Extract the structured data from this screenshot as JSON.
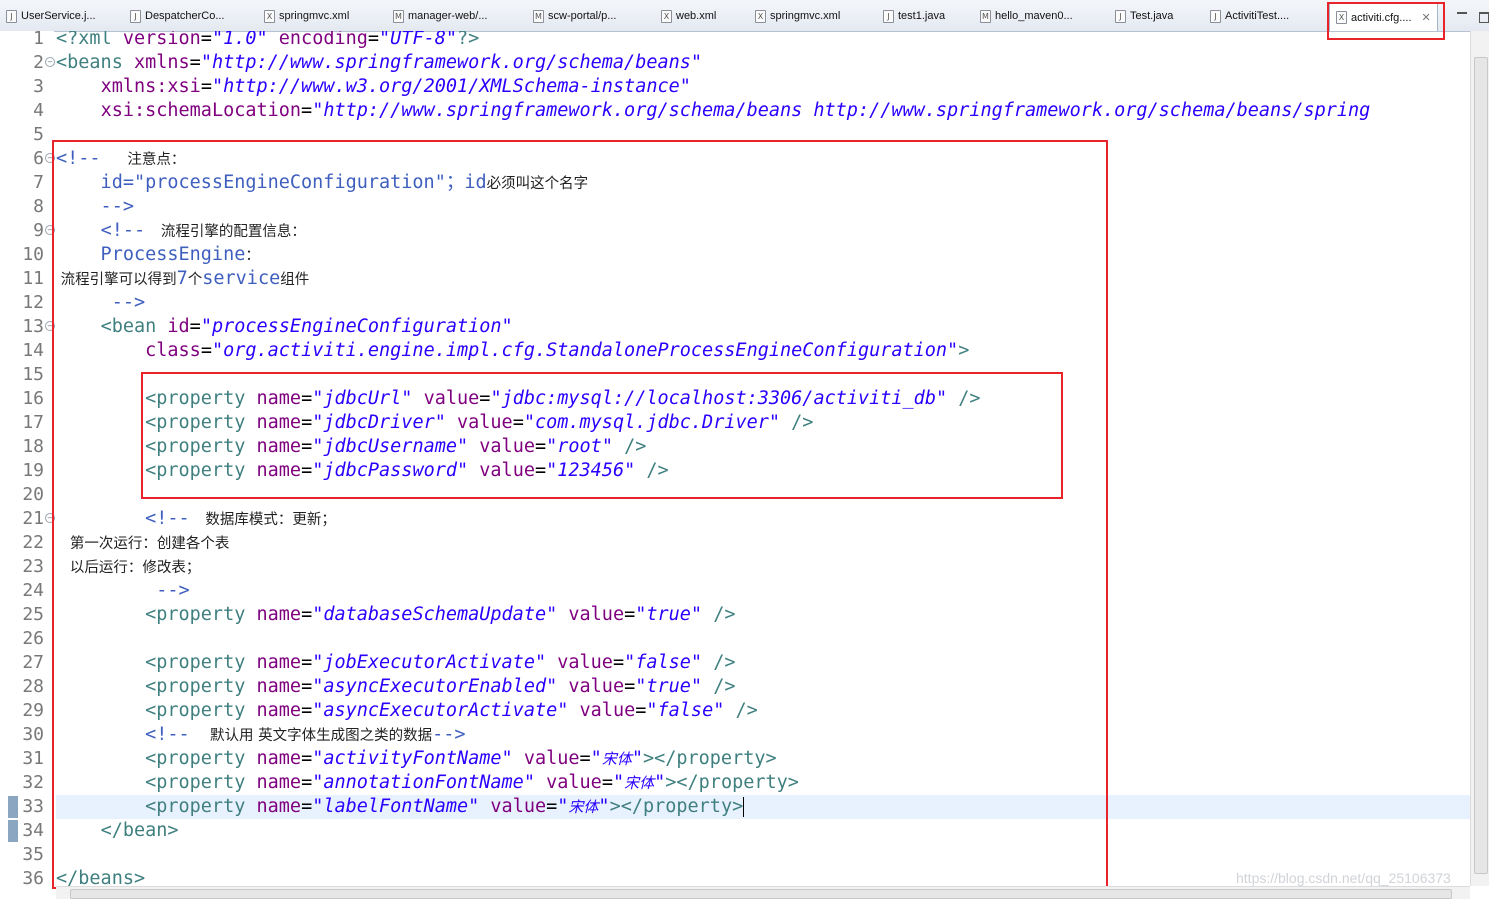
{
  "tabs": [
    {
      "label": "UserService.j...",
      "icon": "java-file-icon"
    },
    {
      "label": "DespatcherCo...",
      "icon": "java-file-icon"
    },
    {
      "label": "springmvc.xml",
      "icon": "xml-file-icon"
    },
    {
      "label": "manager-web/...",
      "icon": "maven-pom-icon"
    },
    {
      "label": "scw-portal/p...",
      "icon": "maven-pom-icon"
    },
    {
      "label": "web.xml",
      "icon": "xml-file-icon"
    },
    {
      "label": "springmvc.xml",
      "icon": "xml-file-icon"
    },
    {
      "label": "test1.java",
      "icon": "java-file-icon"
    },
    {
      "label": "hello_maven0...",
      "icon": "maven-pom-icon"
    },
    {
      "label": "Test.java",
      "icon": "java-file-icon"
    },
    {
      "label": "ActivitiTest....",
      "icon": "java-file-icon"
    },
    {
      "label": "activiti.cfg....",
      "icon": "xml-file-icon",
      "active": true
    }
  ],
  "editor": {
    "line_numbers": [
      "1",
      "2",
      "3",
      "4",
      "5",
      "6",
      "7",
      "8",
      "9",
      "10",
      "11",
      "12",
      "13",
      "14",
      "15",
      "16",
      "17",
      "18",
      "19",
      "20",
      "21",
      "22",
      "23",
      "24",
      "25",
      "26",
      "27",
      "28",
      "29",
      "30",
      "31",
      "32",
      "33",
      "34",
      "35",
      "36"
    ],
    "lines": [
      [
        [
          "t-tag",
          "<?xml "
        ],
        [
          "t-attr",
          "version"
        ],
        [
          "t-txt",
          "="
        ],
        [
          "t-val",
          "\"1.0\""
        ],
        [
          "t-txt",
          " "
        ],
        [
          "t-attr",
          "encoding"
        ],
        [
          "t-txt",
          "="
        ],
        [
          "t-val",
          "\"UTF-8\""
        ],
        [
          "t-tag",
          "?>"
        ]
      ],
      [
        [
          "t-tag",
          "<beans "
        ],
        [
          "t-attr",
          "xmlns"
        ],
        [
          "t-txt",
          "="
        ],
        [
          "t-val",
          "\"http://www.springframework.org/schema/beans\""
        ]
      ],
      [
        [
          "t-txt",
          "    "
        ],
        [
          "t-attr",
          "xmlns:xsi"
        ],
        [
          "t-txt",
          "="
        ],
        [
          "t-val",
          "\"http://www.w3.org/2001/XMLSchema-instance\""
        ]
      ],
      [
        [
          "t-txt",
          "    "
        ],
        [
          "t-attr",
          "xsi:schemaLocation"
        ],
        [
          "t-txt",
          "="
        ],
        [
          "t-val",
          "\"http://www.springframework.org/schema/beans http://www.springframework.org/schema/beans/spring"
        ]
      ],
      [],
      [
        [
          "t-com",
          "<!--  "
        ],
        [
          "t-com-cn",
          " 注意点："
        ]
      ],
      [
        [
          "t-com",
          "    id=\"processEngineConfiguration\"；id"
        ],
        [
          "t-com-cn",
          "必须叫这个名字"
        ]
      ],
      [
        [
          "t-com",
          "    -->"
        ]
      ],
      [
        [
          "t-txt",
          "    "
        ],
        [
          "t-com",
          "<!-- "
        ],
        [
          "t-com-cn",
          " 流程引擎的配置信息："
        ]
      ],
      [
        [
          "t-com",
          "    ProcessEngine"
        ],
        [
          "t-com-cn",
          "："
        ]
      ],
      [
        [
          "t-com-cn",
          " 流程引擎可以得到"
        ],
        [
          "t-com",
          "7"
        ],
        [
          "t-com-cn",
          "个"
        ],
        [
          "t-com",
          "service"
        ],
        [
          "t-com-cn",
          "组件"
        ]
      ],
      [
        [
          "t-com",
          "     -->"
        ]
      ],
      [
        [
          "t-txt",
          "    "
        ],
        [
          "t-tag",
          "<bean "
        ],
        [
          "t-attr",
          "id"
        ],
        [
          "t-txt",
          "="
        ],
        [
          "t-val",
          "\"processEngineConfiguration\""
        ]
      ],
      [
        [
          "t-txt",
          "        "
        ],
        [
          "t-attr",
          "class"
        ],
        [
          "t-txt",
          "="
        ],
        [
          "t-val",
          "\"org.activiti.engine.impl.cfg.StandaloneProcessEngineConfiguration\""
        ],
        [
          "t-tag",
          ">"
        ]
      ],
      [],
      [
        [
          "t-txt",
          "        "
        ],
        [
          "t-tag",
          "<property "
        ],
        [
          "t-attr",
          "name"
        ],
        [
          "t-txt",
          "="
        ],
        [
          "t-val",
          "\"jdbcUrl\""
        ],
        [
          "t-txt",
          " "
        ],
        [
          "t-attr",
          "value"
        ],
        [
          "t-txt",
          "="
        ],
        [
          "t-val",
          "\"jdbc:mysql://localhost:3306/activiti_db\""
        ],
        [
          "t-txt",
          " "
        ],
        [
          "t-tag",
          "/>"
        ]
      ],
      [
        [
          "t-txt",
          "        "
        ],
        [
          "t-tag",
          "<property "
        ],
        [
          "t-attr",
          "name"
        ],
        [
          "t-txt",
          "="
        ],
        [
          "t-val",
          "\"jdbcDriver\""
        ],
        [
          "t-txt",
          " "
        ],
        [
          "t-attr",
          "value"
        ],
        [
          "t-txt",
          "="
        ],
        [
          "t-val",
          "\"com.mysql.jdbc.Driver\""
        ],
        [
          "t-txt",
          " "
        ],
        [
          "t-tag",
          "/>"
        ]
      ],
      [
        [
          "t-txt",
          "        "
        ],
        [
          "t-tag",
          "<property "
        ],
        [
          "t-attr",
          "name"
        ],
        [
          "t-txt",
          "="
        ],
        [
          "t-val",
          "\"jdbcUsername\""
        ],
        [
          "t-txt",
          " "
        ],
        [
          "t-attr",
          "value"
        ],
        [
          "t-txt",
          "="
        ],
        [
          "t-val",
          "\"root\""
        ],
        [
          "t-txt",
          " "
        ],
        [
          "t-tag",
          "/>"
        ]
      ],
      [
        [
          "t-txt",
          "        "
        ],
        [
          "t-tag",
          "<property "
        ],
        [
          "t-attr",
          "name"
        ],
        [
          "t-txt",
          "="
        ],
        [
          "t-val",
          "\"jdbcPassword\""
        ],
        [
          "t-txt",
          " "
        ],
        [
          "t-attr",
          "value"
        ],
        [
          "t-txt",
          "="
        ],
        [
          "t-val",
          "\"123456\""
        ],
        [
          "t-txt",
          " "
        ],
        [
          "t-tag",
          "/>"
        ]
      ],
      [],
      [
        [
          "t-txt",
          "        "
        ],
        [
          "t-com",
          "<!-- "
        ],
        [
          "t-com-cn",
          " 数据库模式：更新；"
        ]
      ],
      [
        [
          "t-com-cn",
          "   第一次运行：创建各个表"
        ]
      ],
      [
        [
          "t-com-cn",
          "   以后运行：修改表；"
        ]
      ],
      [
        [
          "t-com",
          "         -->"
        ]
      ],
      [
        [
          "t-txt",
          "        "
        ],
        [
          "t-tag",
          "<property "
        ],
        [
          "t-attr",
          "name"
        ],
        [
          "t-txt",
          "="
        ],
        [
          "t-val",
          "\"databaseSchemaUpdate\""
        ],
        [
          "t-txt",
          " "
        ],
        [
          "t-attr",
          "value"
        ],
        [
          "t-txt",
          "="
        ],
        [
          "t-val",
          "\"true\""
        ],
        [
          "t-txt",
          " "
        ],
        [
          "t-tag",
          "/>"
        ]
      ],
      [],
      [
        [
          "t-txt",
          "        "
        ],
        [
          "t-tag",
          "<property "
        ],
        [
          "t-attr",
          "name"
        ],
        [
          "t-txt",
          "="
        ],
        [
          "t-val",
          "\"jobExecutorActivate\""
        ],
        [
          "t-txt",
          " "
        ],
        [
          "t-attr",
          "value"
        ],
        [
          "t-txt",
          "="
        ],
        [
          "t-val",
          "\"false\""
        ],
        [
          "t-txt",
          " "
        ],
        [
          "t-tag",
          "/>"
        ]
      ],
      [
        [
          "t-txt",
          "        "
        ],
        [
          "t-tag",
          "<property "
        ],
        [
          "t-attr",
          "name"
        ],
        [
          "t-txt",
          "="
        ],
        [
          "t-val",
          "\"asyncExecutorEnabled\""
        ],
        [
          "t-txt",
          " "
        ],
        [
          "t-attr",
          "value"
        ],
        [
          "t-txt",
          "="
        ],
        [
          "t-val",
          "\"true\""
        ],
        [
          "t-txt",
          " "
        ],
        [
          "t-tag",
          "/>"
        ]
      ],
      [
        [
          "t-txt",
          "        "
        ],
        [
          "t-tag",
          "<property "
        ],
        [
          "t-attr",
          "name"
        ],
        [
          "t-txt",
          "="
        ],
        [
          "t-val",
          "\"asyncExecutorActivate\""
        ],
        [
          "t-txt",
          " "
        ],
        [
          "t-attr",
          "value"
        ],
        [
          "t-txt",
          "="
        ],
        [
          "t-val",
          "\"false\""
        ],
        [
          "t-txt",
          " "
        ],
        [
          "t-tag",
          "/>"
        ]
      ],
      [
        [
          "t-txt",
          "        "
        ],
        [
          "t-com",
          "<!-- "
        ],
        [
          "t-com-cn",
          "  默认用 英文字体生成图之类的数据"
        ],
        [
          "t-com",
          "-->"
        ]
      ],
      [
        [
          "t-txt",
          "        "
        ],
        [
          "t-tag",
          "<property "
        ],
        [
          "t-attr",
          "name"
        ],
        [
          "t-txt",
          "="
        ],
        [
          "t-val",
          "\"activityFontName\""
        ],
        [
          "t-txt",
          " "
        ],
        [
          "t-attr",
          "value"
        ],
        [
          "t-txt",
          "="
        ],
        [
          "t-val",
          "\""
        ],
        [
          "t-val-cn",
          "宋体"
        ],
        [
          "t-val",
          "\""
        ],
        [
          "t-tag",
          "></property>"
        ]
      ],
      [
        [
          "t-txt",
          "        "
        ],
        [
          "t-tag",
          "<property "
        ],
        [
          "t-attr",
          "name"
        ],
        [
          "t-txt",
          "="
        ],
        [
          "t-val",
          "\"annotationFontName\""
        ],
        [
          "t-txt",
          " "
        ],
        [
          "t-attr",
          "value"
        ],
        [
          "t-txt",
          "="
        ],
        [
          "t-val",
          "\""
        ],
        [
          "t-val-cn",
          "宋体"
        ],
        [
          "t-val",
          "\""
        ],
        [
          "t-tag",
          "></property>"
        ]
      ],
      [
        [
          "t-txt",
          "        "
        ],
        [
          "t-tag",
          "<property "
        ],
        [
          "t-attr",
          "name"
        ],
        [
          "t-txt",
          "="
        ],
        [
          "t-val",
          "\"labelFontName\""
        ],
        [
          "t-txt",
          " "
        ],
        [
          "t-attr",
          "value"
        ],
        [
          "t-txt",
          "="
        ],
        [
          "t-val",
          "\""
        ],
        [
          "t-val-cn",
          "宋体"
        ],
        [
          "t-val",
          "\""
        ],
        [
          "t-tag",
          "></property>"
        ]
      ],
      [
        [
          "t-txt",
          "    "
        ],
        [
          "t-tag",
          "</bean>"
        ]
      ],
      [],
      [
        [
          "t-tag",
          "</beans>"
        ]
      ]
    ]
  },
  "watermark": "https://blog.csdn.net/qq_25106373",
  "colors": {
    "tag": "#3f7f7f",
    "attribute": "#7f007f",
    "value": "#2a00ff",
    "comment": "#3f5fbf",
    "annotation_box": "#e8232a",
    "current_line": "#e8f2fe"
  }
}
